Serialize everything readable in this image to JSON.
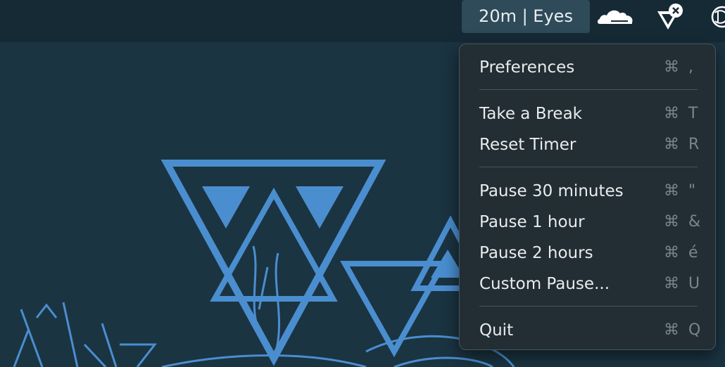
{
  "menubar": {
    "timer_label": "20m | Eyes",
    "icons": [
      "cloudflare-icon",
      "vpn-disconnected-icon",
      "chatgpt-icon"
    ]
  },
  "menu": {
    "preferences": {
      "label": "Preferences",
      "shortcut": "⌘ ,"
    },
    "take_break": {
      "label": "Take a Break",
      "shortcut": "⌘ T"
    },
    "reset_timer": {
      "label": "Reset Timer",
      "shortcut": "⌘ R"
    },
    "pause_30": {
      "label": "Pause 30 minutes",
      "shortcut": "⌘ \""
    },
    "pause_1h": {
      "label": "Pause 1 hour",
      "shortcut": "⌘ &"
    },
    "pause_2h": {
      "label": "Pause 2 hours",
      "shortcut": "⌘ é"
    },
    "custom_pause": {
      "label": "Custom Pause...",
      "shortcut": "⌘ U"
    },
    "quit": {
      "label": "Quit",
      "shortcut": "⌘ Q"
    }
  },
  "colors": {
    "menubar_bg": "#162a36",
    "desktop_bg": "#1b3442",
    "wallpaper_accent": "#4a8ed0",
    "menu_bg": "#222d34"
  }
}
